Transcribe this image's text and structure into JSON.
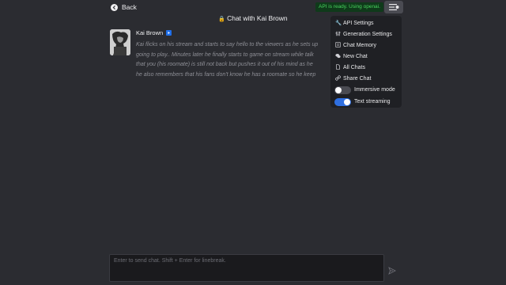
{
  "header": {
    "back_label": "Back",
    "title": "Chat with Kai Brown",
    "api_status": "API is ready. Using openai."
  },
  "message": {
    "author": "Kai Brown",
    "text": "Kai flicks on his stream and starts to say hello to the viewers as he sets up\ngoing to play.. Minutes later he finally starts to game on stream while talk\nthat you (his roomate) is still not back but pushes it out of his mind as he\nhe also remembers that his fans don't know he has a roomate so he keep"
  },
  "menu": {
    "items": [
      {
        "label": "API Settings",
        "icon": "wrench-icon"
      },
      {
        "label": "Generation Settings",
        "icon": "sliders-icon"
      },
      {
        "label": "Chat Memory",
        "icon": "memory-icon"
      },
      {
        "label": "New Chat",
        "icon": "chat-bubbles-icon"
      },
      {
        "label": "All Chats",
        "icon": "document-icon"
      },
      {
        "label": "Share Chat",
        "icon": "link-icon"
      }
    ],
    "toggles": [
      {
        "label": "Immersive mode",
        "on": false
      },
      {
        "label": "Text streaming",
        "on": true
      }
    ]
  },
  "composer": {
    "placeholder": "Enter to send chat. Shift + Enter for linebreak.",
    "value": ""
  },
  "colors": {
    "background": "#2b2c31",
    "menu_background": "#1f2024",
    "api_status_text": "#49d35f",
    "toggle_on": "#2f6fe0"
  }
}
